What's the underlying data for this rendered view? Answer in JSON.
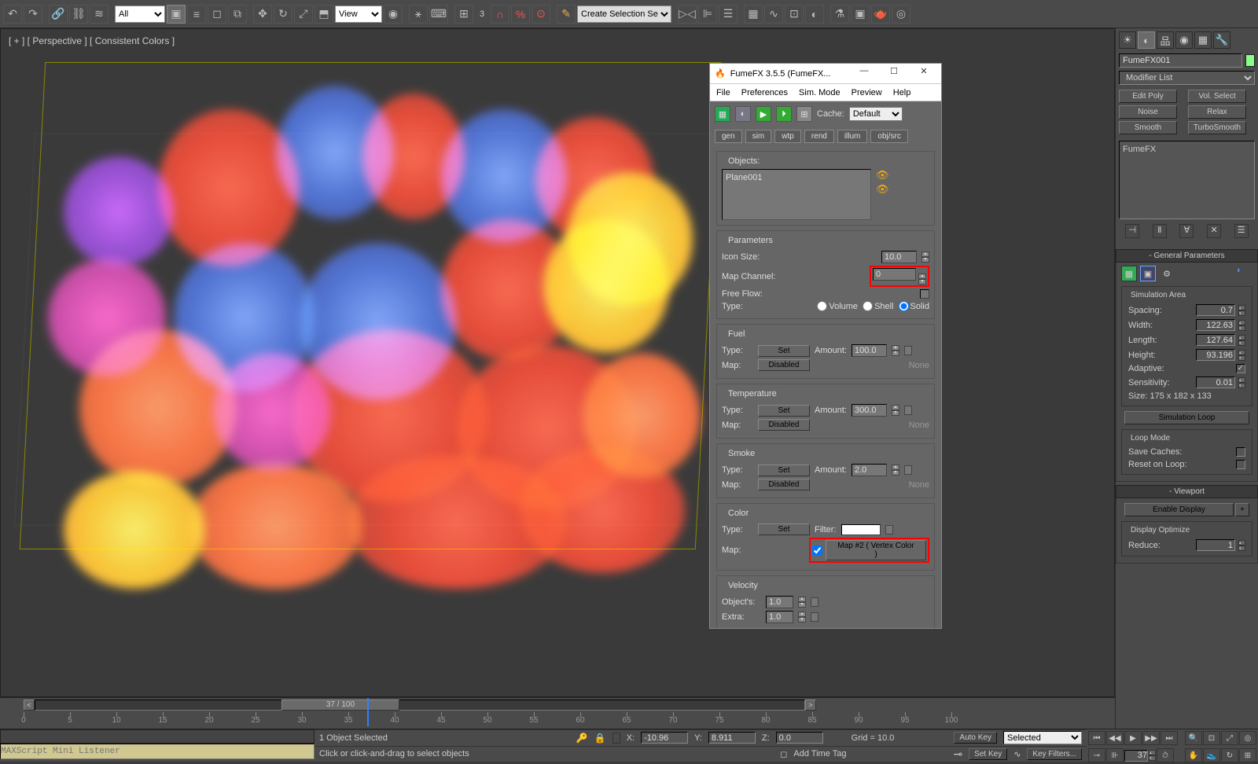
{
  "toolbar": {
    "category_select": "All",
    "viewmode_select": "View",
    "selset_select": "Create Selection Se",
    "spin_value": "3"
  },
  "viewport": {
    "label": "[ + ] [ Perspective ] [ Consistent Colors ]"
  },
  "fume": {
    "title": "FumeFX 3.5.5 (FumeFX...",
    "menu": [
      "File",
      "Preferences",
      "Sim. Mode",
      "Preview",
      "Help"
    ],
    "cache_label": "Cache:",
    "cache_value": "Default",
    "tabs": [
      "gen",
      "sim",
      "wtp",
      "rend",
      "illum",
      "obj/src"
    ],
    "objects_label": "Objects:",
    "objects_value": "Plane001",
    "parameters_label": "Parameters",
    "icon_size_label": "Icon Size:",
    "icon_size_value": "10.0",
    "map_channel_label": "Map Channel:",
    "map_channel_value": "0",
    "free_flow_label": "Free Flow:",
    "type_label": "Type:",
    "type_options": [
      "Volume",
      "Shell",
      "Solid"
    ],
    "type_selected": "Solid",
    "fuel": {
      "header": "Fuel",
      "type_label": "Type:",
      "set_btn": "Set",
      "amount_label": "Amount:",
      "amount_value": "100.0",
      "map_label": "Map:",
      "disabled_btn": "Disabled",
      "none_label": "None"
    },
    "temp": {
      "header": "Temperature",
      "type_label": "Type:",
      "set_btn": "Set",
      "amount_label": "Amount:",
      "amount_value": "300.0",
      "map_label": "Map:",
      "disabled_btn": "Disabled",
      "none_label": "None"
    },
    "smoke": {
      "header": "Smoke",
      "type_label": "Type:",
      "set_btn": "Set",
      "amount_label": "Amount:",
      "amount_value": "2.0",
      "map_label": "Map:",
      "disabled_btn": "Disabled",
      "none_label": "None"
    },
    "color": {
      "header": "Color",
      "type_label": "Type:",
      "set_btn": "Set",
      "filter_label": "Filter:",
      "map_label": "Map:",
      "map_btn": "Map #2  ( Vertex Color )"
    },
    "velocity": {
      "header": "Velocity",
      "object_label": "Object's:",
      "object_value": "1.0",
      "extra_label": "Extra:",
      "extra_value": "1.0"
    }
  },
  "right_panel": {
    "object_name": "FumeFX001",
    "modifier_list_label": "Modifier List",
    "mod_buttons": [
      "Edit Poly",
      "Vol. Select",
      "Noise",
      "Relax",
      "Smooth",
      "TurboSmooth"
    ],
    "stack_item": "FumeFX",
    "rollouts": {
      "general": {
        "title": "General Parameters",
        "sim_area_label": "Simulation Area",
        "spacing_label": "Spacing:",
        "spacing_value": "0.7",
        "width_label": "Width:",
        "width_value": "122.63",
        "length_label": "Length:",
        "length_value": "127.64",
        "height_label": "Height:",
        "height_value": "93.196",
        "adaptive_label": "Adaptive:",
        "sensitivity_label": "Sensitivity:",
        "sensitivity_value": "0.01",
        "size_label": "Size:  175 x 182 x 133",
        "simloop_btn": "Simulation Loop",
        "loopmode_label": "Loop Mode",
        "save_caches_label": "Save Caches:",
        "reset_loop_label": "Reset on Loop:"
      },
      "viewport": {
        "title": "Viewport",
        "enable_display_btn": "Enable Display",
        "display_optimize_label": "Display Optimize",
        "reduce_label": "Reduce:",
        "reduce_value": "1"
      }
    }
  },
  "timeline": {
    "current": "37 / 100",
    "ticks": [
      "0",
      "5",
      "10",
      "15",
      "20",
      "25",
      "30",
      "35",
      "40",
      "45",
      "50",
      "55",
      "60",
      "65",
      "70",
      "75",
      "80",
      "85",
      "90",
      "95",
      "100"
    ]
  },
  "status": {
    "ml_head": "",
    "ml_placeholder": "MAXScript Mini Listener",
    "obj_selected": "1 Object Selected",
    "hint": "Click or click-and-drag to select objects",
    "x_label": "X:",
    "x_value": "-10.96",
    "y_label": "Y:",
    "y_value": "8.911",
    "z_label": "Z:",
    "z_value": "0.0",
    "grid_label": "Grid = 10.0",
    "addtag_label": "Add Time Tag",
    "autokey_label": "Auto Key",
    "setkey_label": "Set Key",
    "keymode_select": "Selected",
    "keyfilters_btn": "Key Filters...",
    "frame_input": "37"
  }
}
